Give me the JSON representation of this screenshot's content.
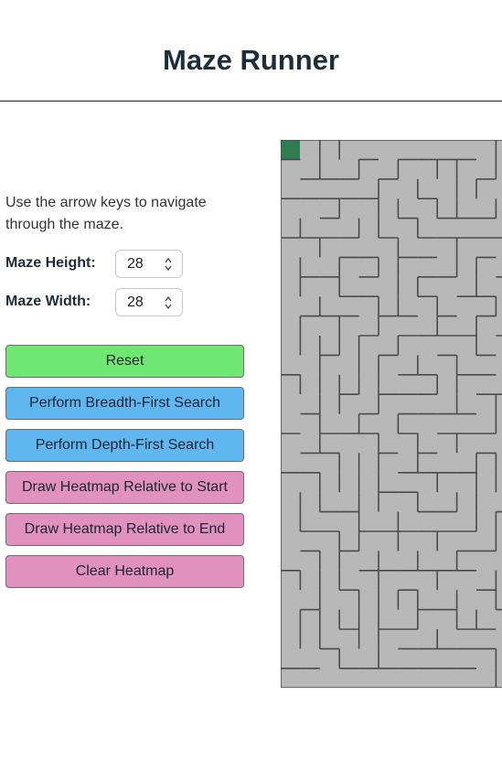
{
  "header": {
    "title": "Maze Runner"
  },
  "instructions": "Use the arrow keys to navigate through the maze.",
  "controls": {
    "height_label": "Maze Height:",
    "height_value": "28",
    "width_label": "Maze Width:",
    "width_value": "28"
  },
  "buttons": {
    "reset": "Reset",
    "bfs": "Perform Breadth-First Search",
    "dfs": "Perform Depth-First Search",
    "heat_start": "Draw Heatmap Relative to Start",
    "heat_end": "Draw Heatmap Relative to End",
    "clear_heat": "Clear Heatmap"
  },
  "colors": {
    "reset": "#6ee872",
    "search": "#60b6ef",
    "heatmap": "#e091bd",
    "maze_bg": "#b8b8b8",
    "maze_wall": "#4a4a4a",
    "player": "#2e7d4f"
  }
}
